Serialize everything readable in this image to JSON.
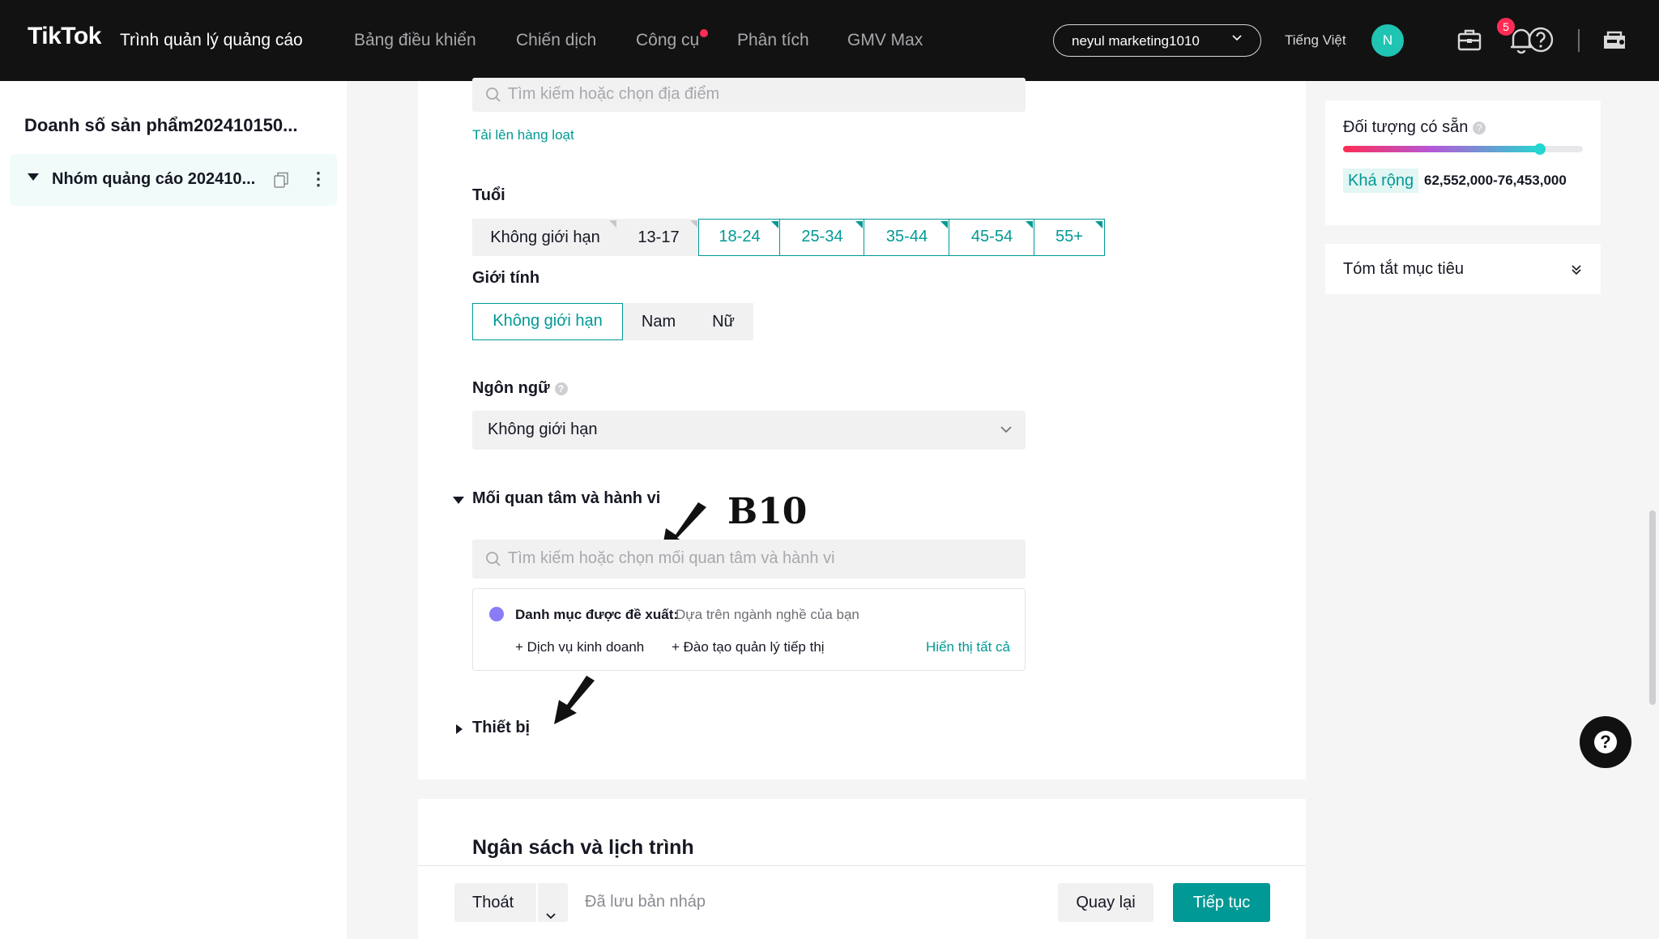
{
  "app": {
    "logo": "TikTok",
    "logo_suffix": "Trình quản lý quảng cáo"
  },
  "nav": {
    "items": [
      "Bảng điều khiển",
      "Chiến dịch",
      "Công cụ",
      "Phân tích",
      "GMV Max"
    ],
    "account": "neyul marketing1010",
    "language": "Tiếng Việt",
    "avatar_initial": "N",
    "notification_count": "5",
    "colors": {
      "accent": "#009995",
      "badge": "#fe2c55",
      "avatar": "#20c4b3"
    },
    "icons": [
      "briefcase-icon",
      "bell-icon",
      "help-circle-icon",
      "user-switch-icon"
    ]
  },
  "sidebar": {
    "title": "Doanh số sản phẩm202410150...",
    "group_label": "Nhóm quảng cáo 202410..."
  },
  "location": {
    "search_placeholder": "Tìm kiếm hoặc chọn địa điểm",
    "bulk_upload_link": "Tải lên hàng loạt"
  },
  "age": {
    "label": "Tuổi",
    "options": [
      {
        "label": "Không giới hạn",
        "selected": false
      },
      {
        "label": "13-17",
        "selected": false
      },
      {
        "label": "18-24",
        "selected": true
      },
      {
        "label": "25-34",
        "selected": true
      },
      {
        "label": "35-44",
        "selected": true
      },
      {
        "label": "45-54",
        "selected": true
      },
      {
        "label": "55+",
        "selected": true
      }
    ]
  },
  "gender": {
    "label": "Giới tính",
    "options": [
      {
        "label": "Không giới hạn",
        "selected": true
      },
      {
        "label": "Nam",
        "selected": false
      },
      {
        "label": "Nữ",
        "selected": false
      }
    ]
  },
  "language": {
    "label": "Ngôn ngữ",
    "value": "Không giới hạn"
  },
  "interests": {
    "label": "Mối quan tâm và hành vi",
    "search_placeholder": "Tìm kiếm hoặc chọn mối quan tâm và hành vi",
    "suggest_title": "Danh mục được đề xuất:",
    "suggest_desc": "Dựa trên ngành nghề của bạn",
    "suggest_items": [
      "Dịch vụ kinh doanh",
      "Đào tạo quản lý tiếp thị"
    ],
    "show_all": "Hiển thị tất cả"
  },
  "device": {
    "label": "Thiết bị"
  },
  "annotation": {
    "label": "B10"
  },
  "budget": {
    "title": "Ngân sách và lịch trình"
  },
  "footer": {
    "exit": "Thoát",
    "saved": "Đã lưu bản nháp",
    "back": "Quay lại",
    "next": "Tiếp tục"
  },
  "audience": {
    "title": "Đối tượng có sẵn",
    "level": "Khá rộng",
    "range": "62,552,000-76,453,000",
    "level_fraction": 0.82
  },
  "summary": {
    "title": "Tóm tắt mục tiêu"
  }
}
